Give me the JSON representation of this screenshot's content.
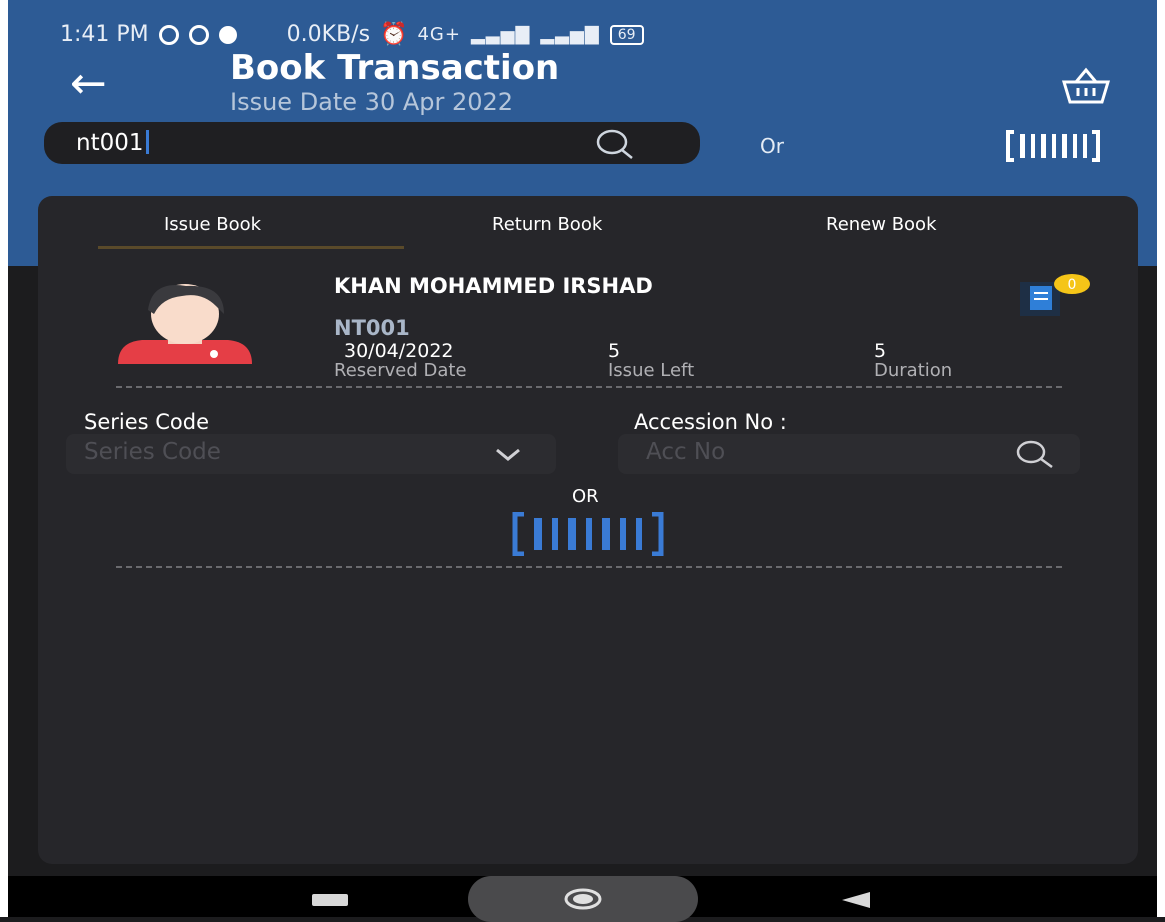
{
  "status_bar": {
    "time": "1:41 PM",
    "speed": "0.0KB/s",
    "network": "4G+",
    "battery": "69"
  },
  "header": {
    "title": "Book Transaction",
    "subtitle": "Issue Date 30 Apr 2022"
  },
  "search": {
    "value": "nt001",
    "or_label": "Or"
  },
  "tabs": [
    {
      "label": "Issue Book",
      "selected": true
    },
    {
      "label": "Return Book",
      "selected": false
    },
    {
      "label": "Renew Book",
      "selected": false
    }
  ],
  "member": {
    "name": "KHAN MOHAMMED IRSHAD",
    "id": "NT001",
    "badge_count": "0",
    "stats": [
      {
        "value": "30/04/2022",
        "label": "Reserved Date"
      },
      {
        "value": "5",
        "label": "Issue Left"
      },
      {
        "value": "5",
        "label": "Duration"
      }
    ]
  },
  "form": {
    "series_label": "Series Code",
    "series_placeholder": "Series Code",
    "accession_label": "Accession No :",
    "accession_placeholder": "Acc No",
    "or_label": "OR"
  },
  "colors": {
    "header_bg": "#2d5b95",
    "card_bg": "#26262a",
    "accent": "#3a7bd5",
    "badge": "#f5c518"
  }
}
